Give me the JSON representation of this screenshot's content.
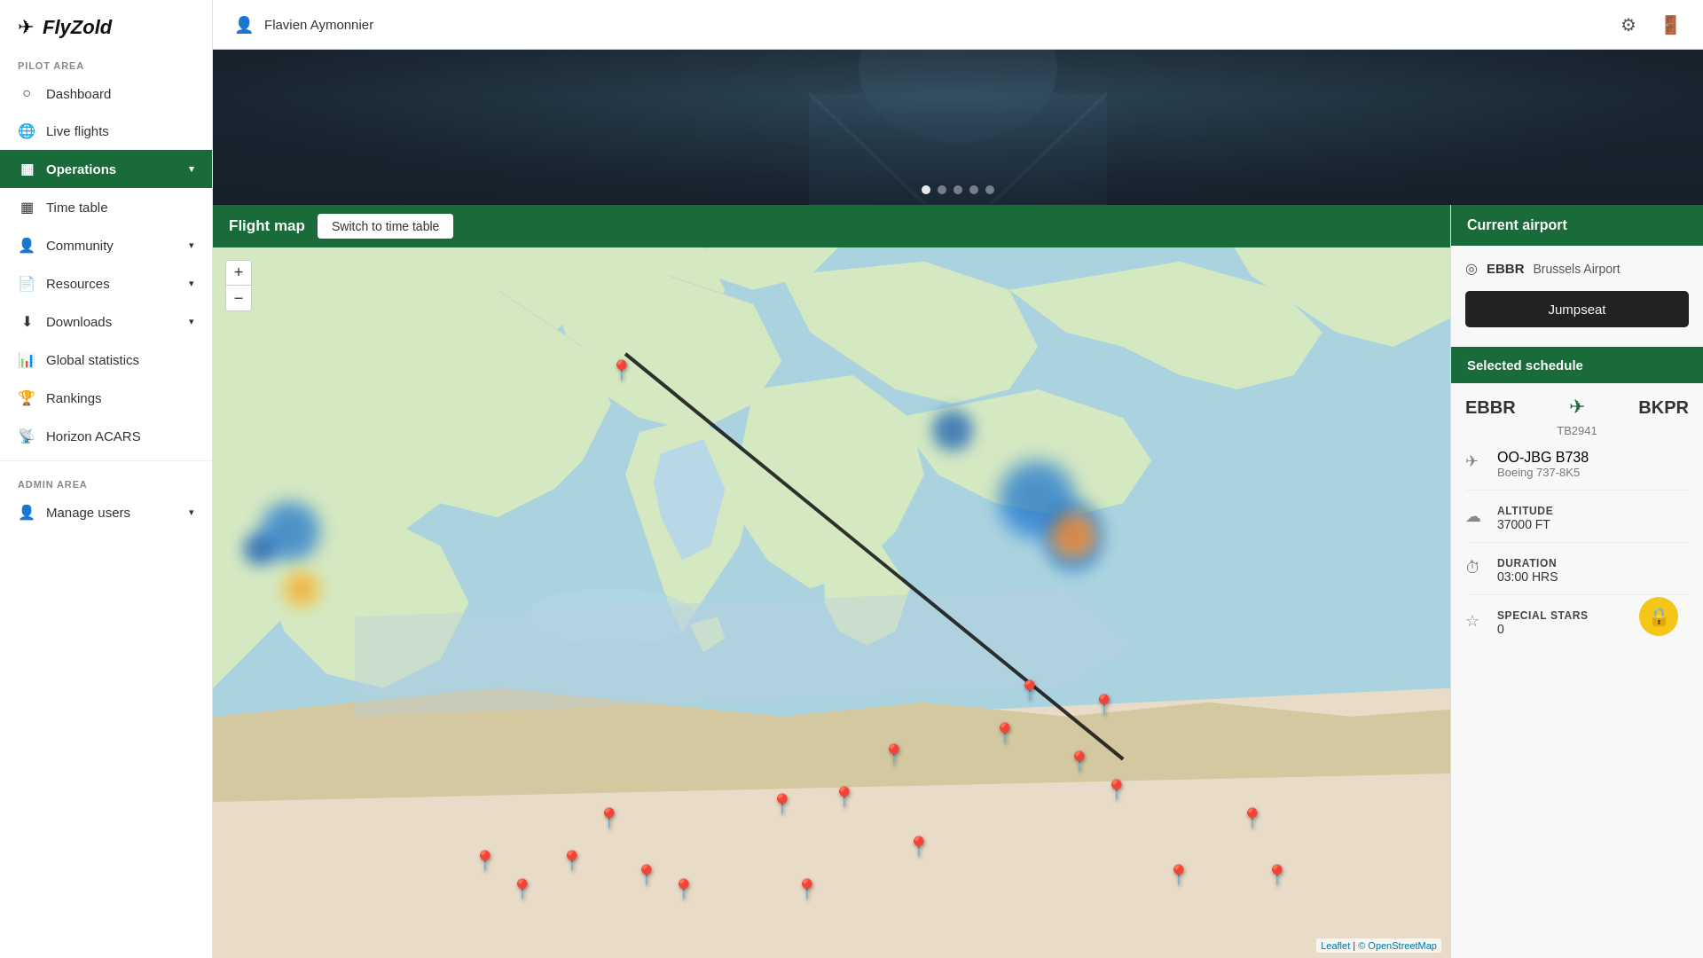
{
  "app": {
    "logo_icon": "✈",
    "logo_text": "FlyZold"
  },
  "sidebar": {
    "pilot_area_label": "PILOT AREA",
    "admin_area_label": "ADMIN AREA",
    "items": [
      {
        "id": "dashboard",
        "icon": "○",
        "label": "Dashboard",
        "active": false,
        "hasChevron": false
      },
      {
        "id": "live-flights",
        "icon": "🌐",
        "label": "Live flights",
        "active": false,
        "hasChevron": false
      },
      {
        "id": "operations",
        "icon": "▦",
        "label": "Operations",
        "active": true,
        "hasChevron": true
      },
      {
        "id": "time-table",
        "icon": "▦",
        "label": "Time table",
        "active": false,
        "hasChevron": false
      },
      {
        "id": "community",
        "icon": "👤",
        "label": "Community",
        "active": false,
        "hasChevron": true
      },
      {
        "id": "resources",
        "icon": "📄",
        "label": "Resources",
        "active": false,
        "hasChevron": true
      },
      {
        "id": "downloads",
        "icon": "⬇",
        "label": "Downloads",
        "active": false,
        "hasChevron": true
      },
      {
        "id": "global-statistics",
        "icon": "📊",
        "label": "Global statistics",
        "active": false,
        "hasChevron": false
      },
      {
        "id": "rankings",
        "icon": "🏆",
        "label": "Rankings",
        "active": false,
        "hasChevron": false
      },
      {
        "id": "horizon-acars",
        "icon": "📡",
        "label": "Horizon ACARS",
        "active": false,
        "hasChevron": false
      }
    ],
    "admin_items": [
      {
        "id": "manage-users",
        "icon": "👤",
        "label": "Manage users",
        "active": false,
        "hasChevron": true
      }
    ]
  },
  "topbar": {
    "user_icon": "👤",
    "username": "Flavien Aymonnier",
    "settings_icon": "⚙",
    "logout_icon": "🚪"
  },
  "hero": {
    "dots": [
      {
        "active": true
      },
      {
        "active": false
      },
      {
        "active": false
      },
      {
        "active": false
      },
      {
        "active": false
      }
    ]
  },
  "map": {
    "title": "Flight map",
    "switch_btn": "Switch to time table",
    "zoom_plus": "+",
    "zoom_minus": "−",
    "attribution_leaflet": "Leaflet",
    "attribution_osm": "© OpenStreetMap"
  },
  "right_panel": {
    "current_airport_header": "Current airport",
    "airport_icon": "◎",
    "airport_code": "EBBR",
    "airport_name": "Brussels Airport",
    "jumpseat_label": "Jumpseat",
    "selected_schedule_header": "Selected schedule",
    "schedule": {
      "from": "EBBR",
      "to": "BKPR",
      "arrow": "✈",
      "flight_number": "TB2941",
      "aircraft_reg": "OO-JBG",
      "aircraft_type": "B738",
      "aircraft_name": "Boeing 737-8K5",
      "altitude_label": "ALTITUDE",
      "altitude_value": "37000 FT",
      "duration_label": "DURATION",
      "duration_value": "03:00 HRS",
      "special_stars_label": "SPECIAL STARS",
      "special_stars_value": "0"
    },
    "lock_icon": "🔒"
  }
}
